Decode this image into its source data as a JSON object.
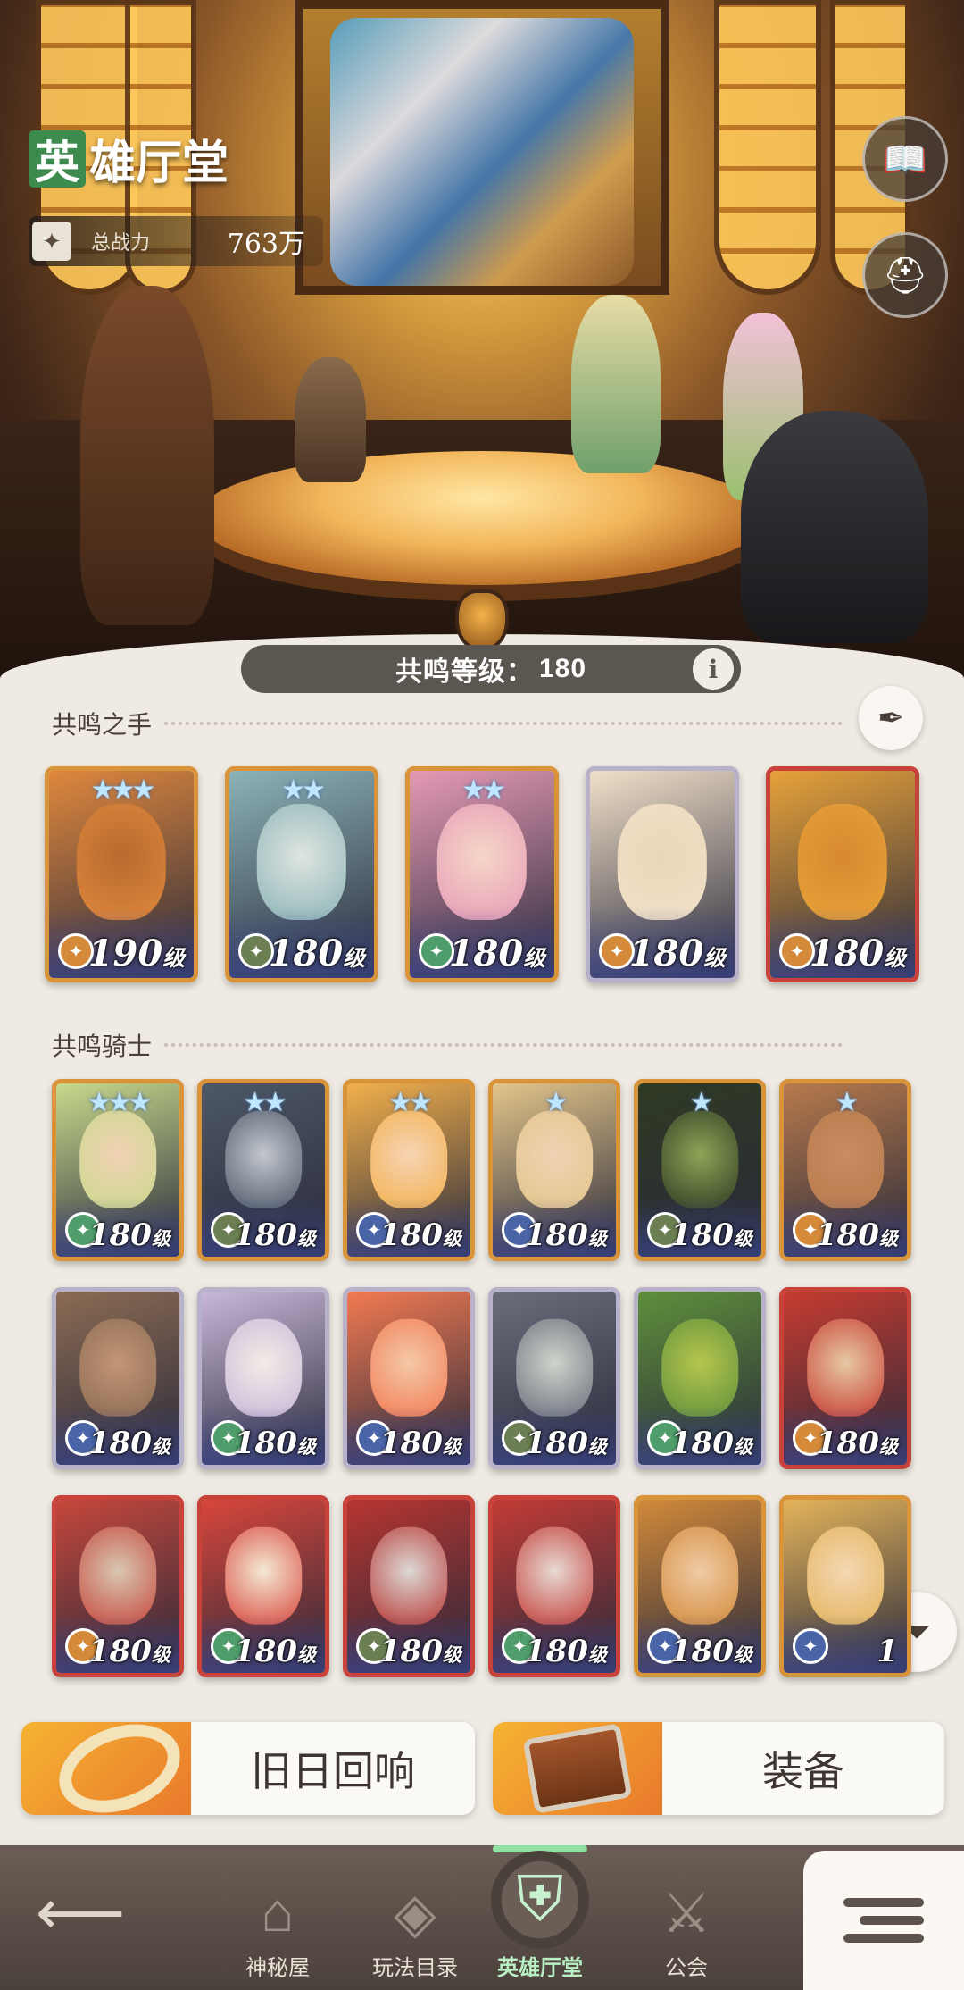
{
  "header": {
    "title_first": "英",
    "title_rest": "雄厅堂",
    "power_label": "总战力",
    "power_value": "763万",
    "book_icon": "codex-book-icon",
    "compare_icon": "dual-helmet-icon"
  },
  "resonance": {
    "label": "共鸣等级：",
    "level": "180",
    "info": "i"
  },
  "sections": {
    "hands": "共鸣之手",
    "knights": "共鸣骑士"
  },
  "hands": [
    {
      "level": "190",
      "unit": "级",
      "stars": "★★★",
      "faction": "lightbearer",
      "frame": "gold",
      "bg": "#e0883d",
      "face": "#b86a2f"
    },
    {
      "level": "180",
      "unit": "级",
      "stars": "★★",
      "faction": "mauler",
      "frame": "gold",
      "bg": "#8bb3b7",
      "face": "#dfe5e0"
    },
    {
      "level": "180",
      "unit": "级",
      "stars": "★★",
      "faction": "wilder",
      "frame": "gold",
      "bg": "#e59ab5",
      "face": "#f6d6c8"
    },
    {
      "level": "180",
      "unit": "级",
      "stars": "",
      "faction": "lightbearer",
      "frame": "silver",
      "bg": "#f1e0c9",
      "face": "#e9d8b8"
    },
    {
      "level": "180",
      "unit": "级",
      "stars": "",
      "faction": "lightbearer",
      "frame": "red",
      "bg": "#e7a23a",
      "face": "#d8892f"
    }
  ],
  "knights": [
    {
      "level": "180",
      "unit": "级",
      "stars": "★★★",
      "faction": "wilder",
      "frame": "gold",
      "bg": "#c9d98c",
      "face": "#f1d2b5"
    },
    {
      "level": "180",
      "unit": "级",
      "stars": "★★",
      "faction": "mauler",
      "frame": "gold",
      "bg": "#4d5866",
      "face": "#c3c7cf"
    },
    {
      "level": "180",
      "unit": "级",
      "stars": "★★",
      "faction": "graveborn",
      "frame": "gold",
      "bg": "#f2b04c",
      "face": "#f6d4b4"
    },
    {
      "level": "180",
      "unit": "级",
      "stars": "★",
      "faction": "graveborn",
      "frame": "gold",
      "bg": "#e3c58a",
      "face": "#f0d2b4"
    },
    {
      "level": "180",
      "unit": "级",
      "stars": "★",
      "faction": "mauler",
      "frame": "gold",
      "bg": "#2f3a23",
      "face": "#8da456"
    },
    {
      "level": "180",
      "unit": "级",
      "stars": "★",
      "faction": "lightbearer",
      "frame": "gold",
      "bg": "#b77a4c",
      "face": "#c98d62"
    },
    {
      "level": "180",
      "unit": "级",
      "stars": "",
      "faction": "graveborn",
      "frame": "silver",
      "bg": "#8b6b53",
      "face": "#c39576"
    },
    {
      "level": "180",
      "unit": "级",
      "stars": "",
      "faction": "wilder",
      "frame": "silver",
      "bg": "#c8b7d9",
      "face": "#f3ece6"
    },
    {
      "level": "180",
      "unit": "级",
      "stars": "",
      "faction": "graveborn",
      "frame": "silver",
      "bg": "#f27a52",
      "face": "#f4c9a8"
    },
    {
      "level": "180",
      "unit": "级",
      "stars": "",
      "faction": "mauler",
      "frame": "silver",
      "bg": "#6a6e7b",
      "face": "#cfd4cc"
    },
    {
      "level": "180",
      "unit": "级",
      "stars": "",
      "faction": "wilder",
      "frame": "silver",
      "bg": "#5e8f3b",
      "face": "#b7c64e"
    },
    {
      "level": "180",
      "unit": "级",
      "stars": "",
      "faction": "lightbearer",
      "frame": "red",
      "bg": "#c63b30",
      "face": "#e7c8a4"
    },
    {
      "level": "180",
      "unit": "级",
      "stars": "",
      "faction": "lightbearer",
      "frame": "red",
      "bg": "#c5473b",
      "face": "#d9c7b2"
    },
    {
      "level": "180",
      "unit": "级",
      "stars": "",
      "faction": "wilder",
      "frame": "red",
      "bg": "#d8463b",
      "face": "#f4e9d4"
    },
    {
      "level": "180",
      "unit": "级",
      "stars": "",
      "faction": "mauler",
      "frame": "red",
      "bg": "#b63530",
      "face": "#ddd9d6"
    },
    {
      "level": "180",
      "unit": "级",
      "stars": "",
      "faction": "wilder",
      "frame": "red",
      "bg": "#c23b35",
      "face": "#e8d9d3"
    },
    {
      "level": "180",
      "unit": "级",
      "stars": "",
      "faction": "graveborn",
      "frame": "gold",
      "bg": "#d28a3a",
      "face": "#f0cba5"
    },
    {
      "level": "1",
      "unit": "",
      "stars": "",
      "faction": "graveborn",
      "frame": "gold",
      "bg": "#e4b45b",
      "face": "#f4d7b3"
    }
  ],
  "actions": {
    "echo": "旧日回响",
    "equip": "装备"
  },
  "filter_icon": "filter-icon",
  "nav": {
    "back_icon": "back-arrow-icon",
    "mystery": "神秘屋",
    "catalog": "玩法目录",
    "hall": "英雄厅堂",
    "guild": "公会",
    "menu_icon": "menu-icon"
  },
  "faction_colors": {
    "lightbearer": "#d58a3a",
    "mauler": "#6b7f52",
    "wilder": "#4f9d6a",
    "graveborn": "#4a64a8"
  }
}
